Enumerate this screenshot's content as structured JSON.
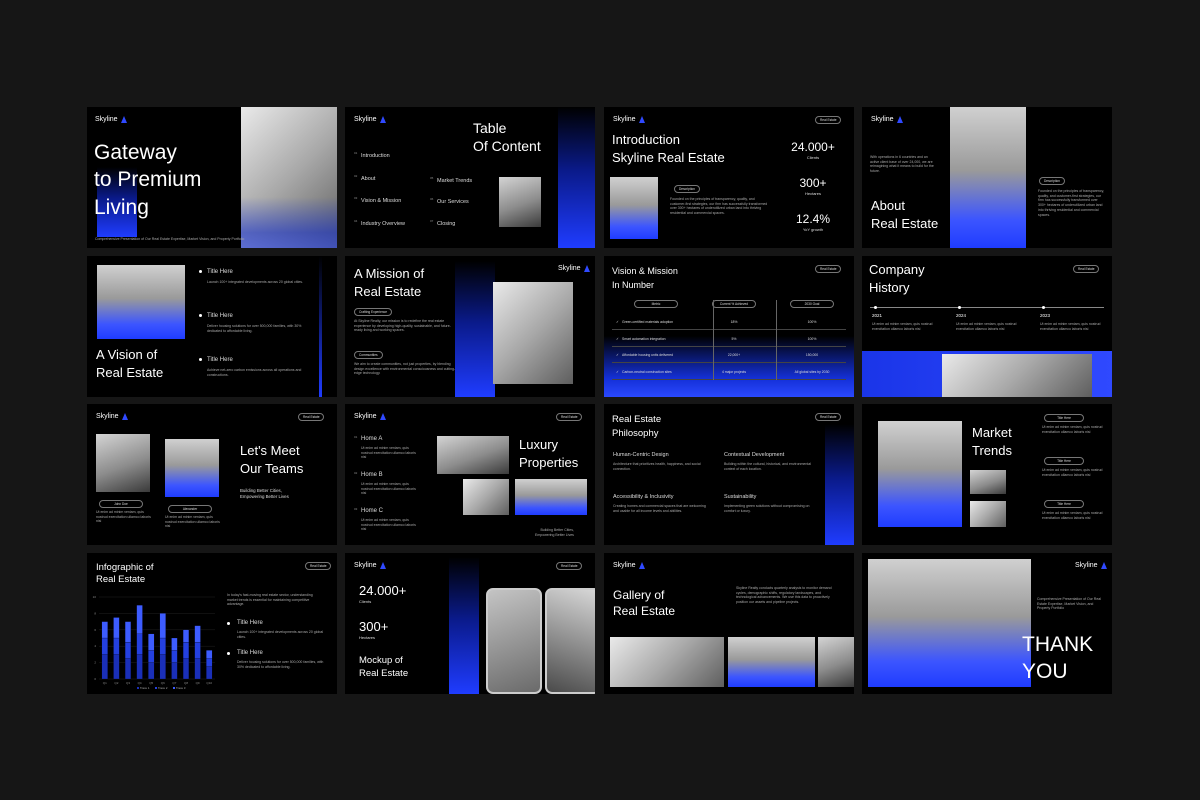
{
  "brand": "Skyline",
  "colors": {
    "background": "#161616",
    "slide": "#000000",
    "accent": "#2a48ff"
  },
  "s1": {
    "title": "Gateway\nto Premium\nLiving",
    "caption": "Comprehensive Presentation of Our Real Estate Expertise, Market Vision, and Property Portfolio"
  },
  "s2": {
    "title": "Table\nOf Content",
    "items": [
      {
        "num": "01",
        "label": "Introduction"
      },
      {
        "num": "02",
        "label": "About"
      },
      {
        "num": "03",
        "label": "Vision & Mission"
      },
      {
        "num": "04",
        "label": "Industry Overview"
      },
      {
        "num": "05",
        "label": "Market Trends"
      },
      {
        "num": "06",
        "label": "Our Services"
      },
      {
        "num": "07",
        "label": "Closing"
      }
    ]
  },
  "s3": {
    "title": "Introduction\nSkyline Real Estate",
    "badge": "Real Estate",
    "pill": "Description",
    "body": "Founded on the principles of transparency, quality, and customer-first strategies, our firm has successfully transformed over 300+ hectares of underutilized urban land into thriving residential and commercial spaces.",
    "stats": [
      {
        "value": "24.000+",
        "label": "Clients"
      },
      {
        "value": "300+",
        "label": "Hectares"
      },
      {
        "value": "12.4%",
        "label": "YoY growth"
      }
    ]
  },
  "s4": {
    "title": "About\nReal Estate",
    "intro": "With operations in 6 countries and an active client base of over 24,000, we are reimagining what it means to build for the future.",
    "pill": "Description",
    "body": "Founded on the principles of transparency, quality, and customer-first strategies, our firm has successfully transformed over 300+ hectares of underutilized urban land into thriving residential and commercial spaces."
  },
  "s5": {
    "title": "A Vision of\nReal Estate",
    "items": [
      {
        "h": "Title Here",
        "p": "Launch 100+ integrated developments across 20 global cities."
      },
      {
        "h": "Title Here",
        "p": "Deliver housing solutions for over 500,000 families, with 30% dedicated to affordable living."
      },
      {
        "h": "Title Here",
        "p": "Achieve net-zero carbon emissions across all operations and constructions."
      }
    ]
  },
  "s6": {
    "title": "A Mission of\nReal Estate",
    "pill1": "Crafting Experience",
    "p1": "At Skyline Realty, our mission is to redefine the real estate experience by developing high-quality, sustainable, and future-ready living and working spaces.",
    "pill2": "Communities",
    "p2": "We aim to create communities, not just properties, by blending design excellence with environmental consciousness and cutting-edge technology."
  },
  "s7": {
    "title": "Vision & Mission\nIn Number",
    "badge": "Real Estate",
    "headers": [
      "Metric",
      "Current % Achieved",
      "2030 Goal"
    ],
    "rows": [
      [
        "Green-certified materials adoption",
        "18%",
        "100%"
      ],
      [
        "Smart automation integration",
        "5%",
        "100%"
      ],
      [
        "Affordable housing units delivered",
        "22,000+",
        "150,000"
      ],
      [
        "Carbon-neutral construction sites",
        "4 major projects",
        "All global sites by 2030"
      ]
    ]
  },
  "s8": {
    "title": "Company\nHistory",
    "badge": "Real Estate",
    "events": [
      {
        "year": "2021",
        "p": "Ut enim ad minim veniam, quis nostrud exercitation ullamco laboris nisi"
      },
      {
        "year": "2024",
        "p": "Ut enim ad minim veniam, quis nostrud exercitation ullamco laboris nisi"
      },
      {
        "year": "2023",
        "p": "Ut enim ad minim veniam, quis nostrud exercitation ullamco laboris nisi"
      }
    ]
  },
  "s9": {
    "title": "Let's Meet\nOur Teams",
    "badge": "Real Estate",
    "sub": "Building Better Cities,\nEmpowering Better Lives",
    "people": [
      {
        "name": "John Doe",
        "p": "Ut enim ad minim veniam, quis nostrud exercitation ullamco laboris nisi"
      },
      {
        "name": "Alexander",
        "p": "Ut enim ad minim veniam, quis nostrud exercitation ullamco laboris nisi"
      }
    ]
  },
  "s10": {
    "title": "Luxury\nProperties",
    "badge": "Real Estate",
    "sub": "Building Better Cities,\nEmpowering Better Lives",
    "homes": [
      {
        "h": "Home A",
        "p": "Ut enim ad minim veniam, quis nostrud exercitation ullamco laboris nisi"
      },
      {
        "h": "Home B",
        "p": "Ut enim ad minim veniam, quis nostrud exercitation ullamco laboris nisi"
      },
      {
        "h": "Home C",
        "p": "Ut enim ad minim veniam, quis nostrud exercitation ullamco laboris nisi"
      }
    ]
  },
  "s11": {
    "title": "Real Estate\nPhilosophy",
    "badge": "Real Estate",
    "items": [
      {
        "h": "Human-Centric Design",
        "p": "Architecture that prioritizes health, happiness, and social connection."
      },
      {
        "h": "Contextual Development",
        "p": "Building within the cultural, historical, and environmental context of each location."
      },
      {
        "h": "Accessibility & Inclusivity",
        "p": "Creating homes and commercial spaces that are welcoming and usable for all income levels and abilities."
      },
      {
        "h": "Sustainability",
        "p": "Implementing green solutions without compromising on comfort or luxury."
      }
    ]
  },
  "s12": {
    "title": "Market\nTrends",
    "items": [
      {
        "pill": "Title Here",
        "p": "Ut enim ad minim veniam, quis nostrud exercitation ullamco laboris nisi"
      },
      {
        "pill": "Title Here",
        "p": "Ut enim ad minim veniam, quis nostrud exercitation ullamco laboris nisi"
      },
      {
        "pill": "Title Here",
        "p": "Ut enim ad minim veniam, quis nostrud exercitation ullamco laboris nisi"
      }
    ]
  },
  "s13": {
    "title": "Infographic of\nReal Estate",
    "badge": "Real Estate",
    "intro": "In today's fast-moving real estate sector, understanding market trends is essential for maintaining competitive advantage.",
    "items": [
      {
        "h": "Title Here",
        "p": "Launch 100+ integrated developments across 20 global cities."
      },
      {
        "h": "Title Here",
        "p": "Deliver housing solutions for over 500,000 families, with 30% dedicated to affordable living."
      }
    ]
  },
  "s14": {
    "title": "Mockup of\nReal Estate",
    "badge": "Real Estate",
    "stats": [
      {
        "value": "24.000+",
        "label": "Clients"
      },
      {
        "value": "300+",
        "label": "Hectares"
      }
    ]
  },
  "s15": {
    "title": "Gallery of\nReal Estate",
    "body": "Skyline Realty conducts quarterly analysis to monitor demand cycles, demographic shifts, regulatory landscapes, and technological advancements. We use this data to proactively position our assets and pipeline projects."
  },
  "s16": {
    "title": "THANK\nYOU",
    "caption": "Comprehensive Presentation of Our Real Estate Expertise, Market Vision, and Property Portfolio"
  },
  "chart_data": {
    "type": "bar",
    "categories": [
      "Q1",
      "Q2",
      "Q3",
      "Q4",
      "Q5",
      "Q6",
      "Q7",
      "Q8",
      "Q9",
      "Q10"
    ],
    "series": [
      {
        "name": "Trace 1",
        "values": [
          3,
          3,
          2.5,
          3,
          2,
          3,
          2,
          2.5,
          2.5,
          1.5
        ]
      },
      {
        "name": "Trace 2",
        "values": [
          2,
          2,
          2,
          2.5,
          1.5,
          2,
          1.5,
          2,
          2,
          1
        ]
      },
      {
        "name": "Trace 3",
        "values": [
          2,
          2.5,
          2.5,
          3.5,
          2,
          3,
          1.5,
          1.5,
          2,
          1
        ]
      }
    ],
    "ylim": [
      0,
      10
    ],
    "yticks": [
      "0",
      "2",
      "4",
      "6",
      "8",
      "10"
    ]
  }
}
